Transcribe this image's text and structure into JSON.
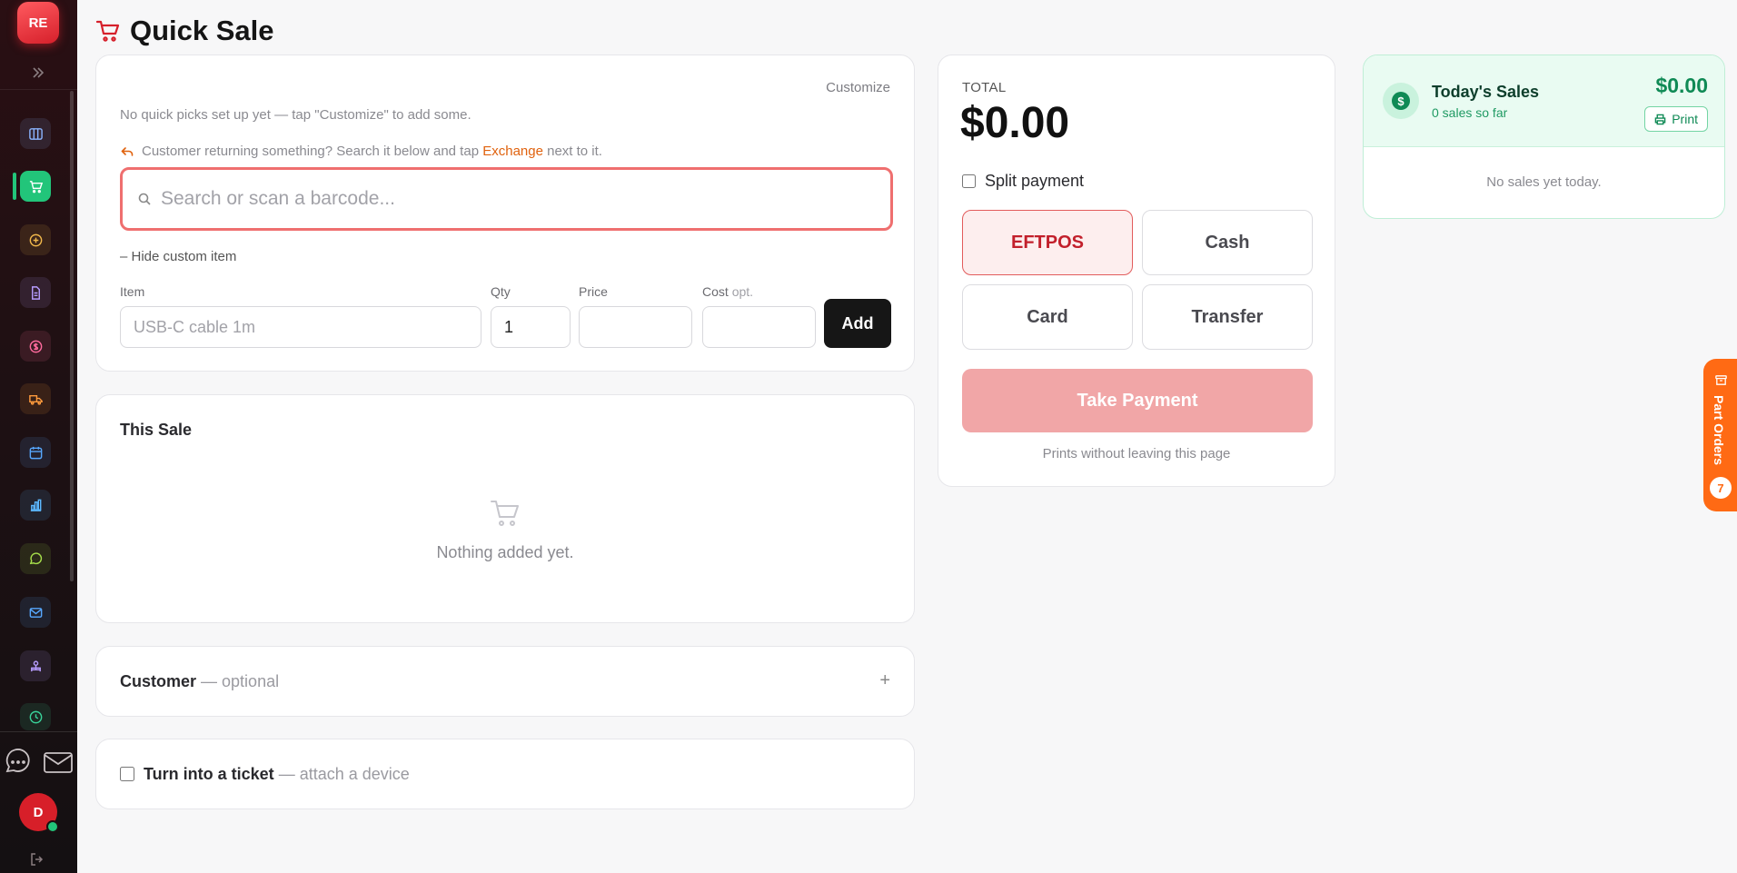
{
  "brand": {
    "initials": "RE"
  },
  "sidebar": {
    "nav": [
      {
        "name": "board",
        "color": "#8ab4ff"
      },
      {
        "name": "quick-sale",
        "color": "#ffffff"
      },
      {
        "name": "add",
        "color": "#f2b94b"
      },
      {
        "name": "documents",
        "color": "#b79cff"
      },
      {
        "name": "payments",
        "color": "#ff6b9e"
      },
      {
        "name": "repairs",
        "color": "#ff9b3d"
      },
      {
        "name": "calendar",
        "color": "#57a8ff"
      },
      {
        "name": "reports",
        "color": "#5cb8ff"
      },
      {
        "name": "chat",
        "color": "#a7e04b"
      },
      {
        "name": "mail",
        "color": "#57a8ff"
      },
      {
        "name": "team",
        "color": "#b79cff"
      },
      {
        "name": "clock",
        "color": "#39d39a"
      }
    ],
    "user_initial": "D"
  },
  "header": {
    "title": "Quick Sale"
  },
  "quick": {
    "customize": "Customize",
    "no_picks": "No quick picks set up yet — tap \"Customize\" to add some.",
    "returning_prefix": "Customer returning something? Search it below and tap",
    "exchange": "Exchange",
    "returning_suffix": "next to it.",
    "search_placeholder": "Search or scan a barcode...",
    "hide_custom": "– Hide custom item",
    "item_label": "Item",
    "qty_label": "Qty",
    "price_label": "Price",
    "cost_label": "Cost",
    "cost_opt": "opt.",
    "item_placeholder": "USB-C cable 1m",
    "qty_value": "1",
    "price_value": "",
    "cost_value": "",
    "add": "Add"
  },
  "sale": {
    "title": "This Sale",
    "empty": "Nothing added yet."
  },
  "customer": {
    "label": "Customer",
    "sub": "— optional",
    "toggle": "+"
  },
  "ticket": {
    "label": "Turn into a ticket",
    "sub": "— attach a device"
  },
  "payment": {
    "total_label": "TOTAL",
    "total": "$0.00",
    "split": "Split payment",
    "methods": [
      "EFTPOS",
      "Cash",
      "Card",
      "Transfer"
    ],
    "selected": "EFTPOS",
    "take": "Take Payment",
    "note": "Prints without leaving this page"
  },
  "today": {
    "title": "Today's Sales",
    "count": "0 sales so far",
    "amount": "$0.00",
    "print": "Print",
    "empty": "No sales yet today."
  },
  "part_orders": {
    "label": "Part Orders",
    "count": "7"
  },
  "colors": {
    "accent": "#d6202b",
    "success": "#0f8a55",
    "orange": "#ff6a14"
  }
}
